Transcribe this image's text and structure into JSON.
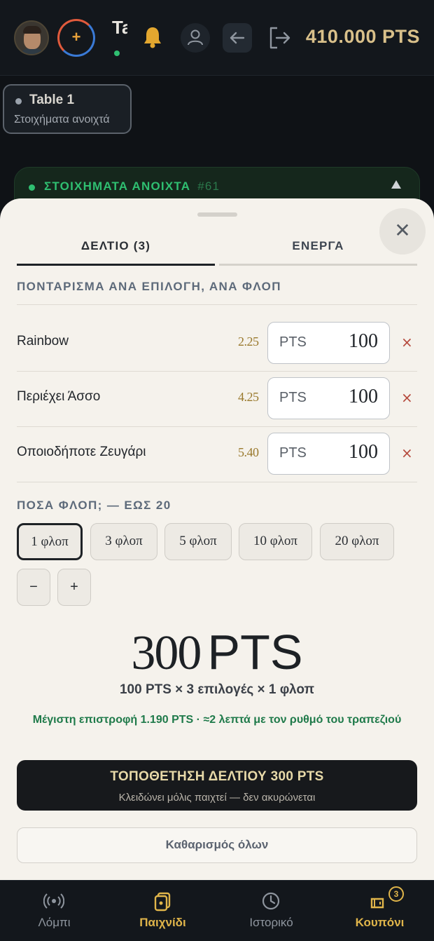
{
  "header": {
    "table_initial": "Ta",
    "balance": "410.000 PTS"
  },
  "background": {
    "table_chip": {
      "title": "Table 1",
      "subtitle": "Στοιχήματα ανοιχτά"
    },
    "panel": {
      "title": "ΣΤΟΙΧΗΜΑΤΑ ΑΝΟΙΧΤΑ",
      "number": "#61"
    }
  },
  "sheet": {
    "close_icon": "close-icon",
    "tabs": [
      {
        "label": "ΔΕΛΤΙΟ (3)",
        "selected": true
      },
      {
        "label": "ΕΝΕΡΓΑ",
        "selected": false
      }
    ],
    "stake_section_label": "ΠΟΝΤΑΡΙΣΜΑ ΑΝΑ ΕΠΙΛΟΓΗ, ΑΝΑ ΦΛΟΠ",
    "selections": [
      {
        "name": "Rainbow",
        "odds": "2.25",
        "currency": "PTS",
        "stake": "100",
        "remove": "×"
      },
      {
        "name": "Περιέχει Άσσο",
        "odds": "4.25",
        "currency": "PTS",
        "stake": "100",
        "remove": "×"
      },
      {
        "name": "Οποιοδήποτε Ζευγάρι",
        "odds": "5.40",
        "currency": "PTS",
        "stake": "100",
        "remove": "×"
      }
    ],
    "flops_label": "ΠΟΣΑ ΦΛΟΠ; — ΕΩΣ 20",
    "flop_options": [
      {
        "label": "1 φλοπ",
        "selected": true
      },
      {
        "label": "3 φλοπ",
        "selected": false
      },
      {
        "label": "5 φλοπ",
        "selected": false
      },
      {
        "label": "10 φλοπ",
        "selected": false
      },
      {
        "label": "20 φλοπ",
        "selected": false
      }
    ],
    "decrement": "−",
    "increment": "+",
    "total_amount": "300",
    "total_currency": "PTS",
    "formula": "100 PTS × 3 επιλογές × 1 φλοπ",
    "max_return": "Μέγιστη επιστροφή 1.190 PTS · ≈2 λεπτά με τον ρυθμό του τραπεζιού",
    "place_button": {
      "title": "ΤΟΠΟΘΕΤΗΣΗ ΔΕΛΤΙΟΥ 300 PTS",
      "subtitle": "Κλειδώνει μόλις παιχτεί — δεν ακυρώνεται"
    },
    "clear_button": "Καθαρισμός όλων"
  },
  "bottom_nav": [
    {
      "label": "Λόμπι",
      "icon": "broadcast-icon",
      "active": false
    },
    {
      "label": "Παιχνίδι",
      "icon": "cards-icon",
      "active": true
    },
    {
      "label": "Ιστορικό",
      "icon": "history-icon",
      "active": false
    },
    {
      "label": "Κουπόνι",
      "icon": "coupon-icon",
      "active": true,
      "badge": "3"
    }
  ],
  "colors": {
    "accent_gold": "#e0b54a",
    "balance_gold": "#d9c08a",
    "return_green": "#1f7a4a",
    "remove_red": "#b5493c",
    "sheet_bg": "#f5f2ec"
  }
}
